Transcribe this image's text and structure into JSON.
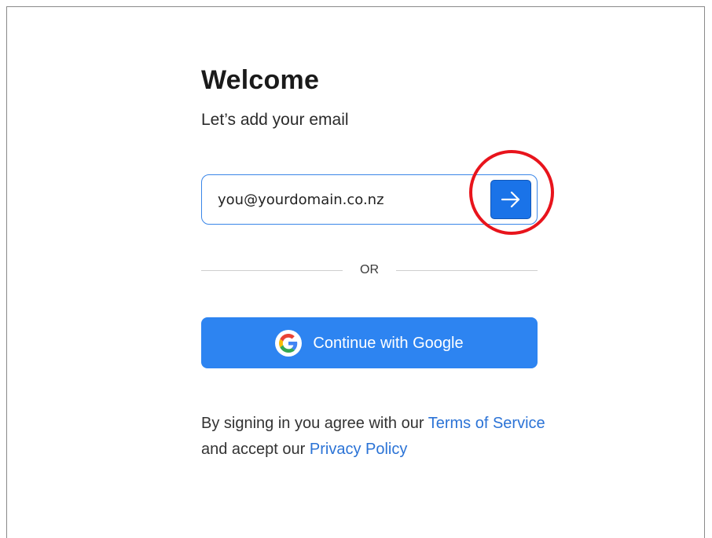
{
  "header": {
    "title": "Welcome",
    "subtitle": "Let’s add your email"
  },
  "email": {
    "value": "you@yourdomain.co.nz",
    "submit_icon": "arrow-right-icon"
  },
  "divider": {
    "label": "OR"
  },
  "google": {
    "label": "Continue with Google",
    "icon": "google-logo-icon"
  },
  "terms": {
    "prefix": "By signing in you agree with our ",
    "terms_link": "Terms of Service",
    "middle": " and accept our ",
    "privacy_link": "Privacy Policy"
  },
  "colors": {
    "primary": "#2d84f1",
    "link": "#2b73d6",
    "annotation": "#e8141c"
  }
}
